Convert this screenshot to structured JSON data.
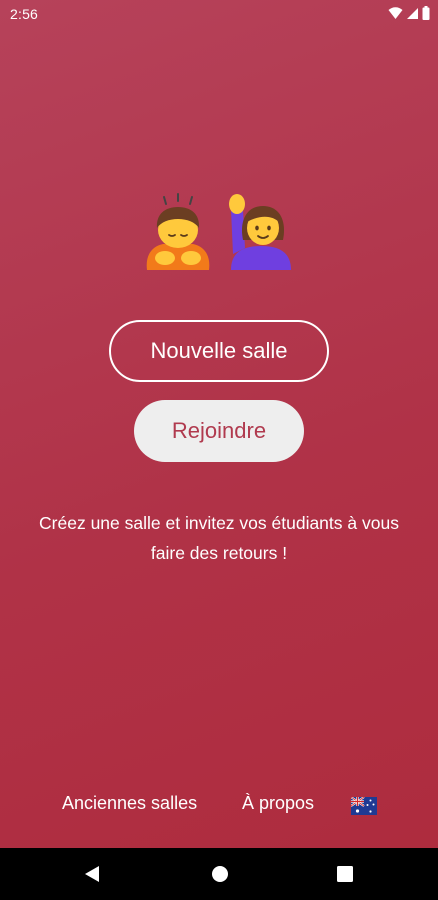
{
  "status_bar": {
    "time": "2:56",
    "icons": [
      "wifi-icon",
      "cellular-signal-icon",
      "battery-icon"
    ]
  },
  "hero": {
    "emojis": [
      "person-bowing-emoji",
      "woman-raising-hand-emoji"
    ]
  },
  "actions": {
    "new_room_label": "Nouvelle salle",
    "join_label": "Rejoindre"
  },
  "tagline": "Créez une salle et invitez vos étudiants à vous faire des retours !",
  "footer": {
    "old_rooms_label": "Anciennes salles",
    "about_label": "À propos",
    "language_icon": "australia-flag-icon"
  },
  "navigation": {
    "buttons": [
      "back-icon",
      "home-icon",
      "recents-icon"
    ]
  },
  "colors": {
    "background": "#b03547",
    "join_button_bg": "#eeeeee",
    "join_button_text": "#b03a4e"
  }
}
